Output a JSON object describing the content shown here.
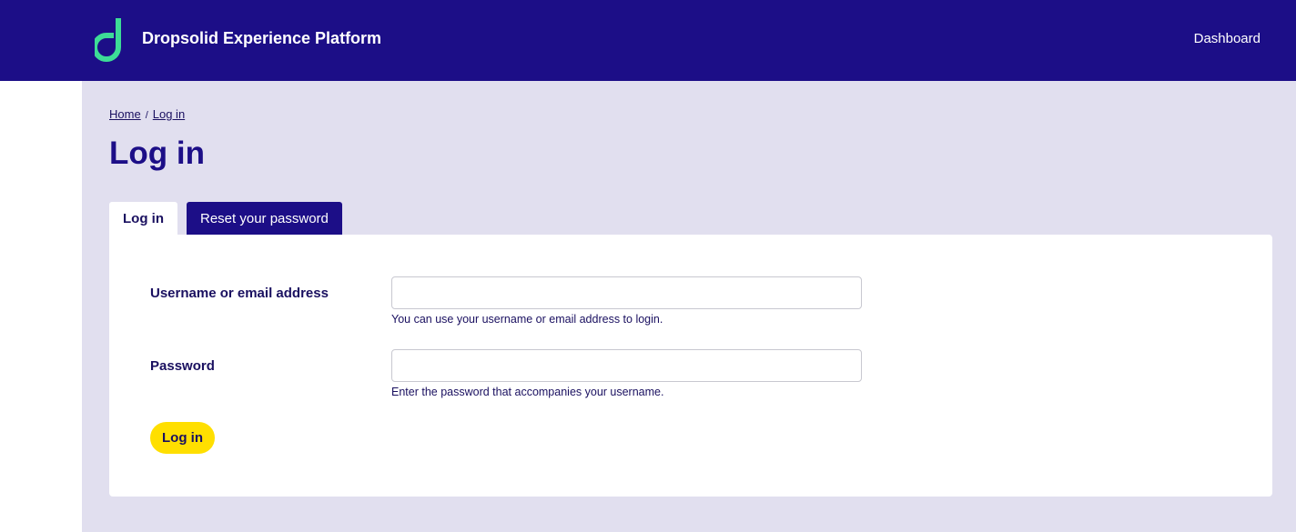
{
  "header": {
    "site_name": "Dropsolid Experience Platform",
    "logo_icon": "dropsolid-d-logo",
    "logo_color": "#3ddc97",
    "nav_link": "Dashboard",
    "background": "#1c0e87"
  },
  "breadcrumb": {
    "items": [
      "Home",
      "Log in"
    ],
    "separator": "/"
  },
  "page_title": "Log in",
  "tabs": [
    {
      "label": "Log in",
      "active": true
    },
    {
      "label": "Reset your password",
      "active": false
    }
  ],
  "form": {
    "username": {
      "label": "Username or email address",
      "value": "",
      "help": "You can use your username or email address to login."
    },
    "password": {
      "label": "Password",
      "value": "",
      "help": "Enter the password that accompanies your username."
    },
    "submit_label": "Log in",
    "submit_color": "#ffdf00"
  }
}
